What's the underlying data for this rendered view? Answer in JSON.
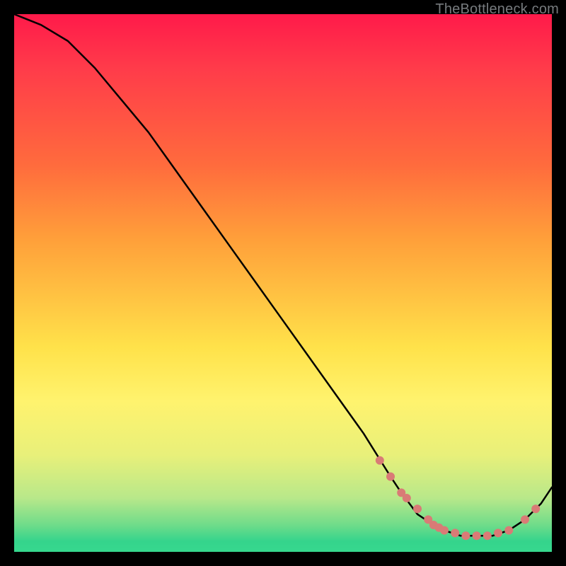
{
  "attribution": "TheBottleneck.com",
  "colors": {
    "background": "#000000",
    "curve": "#000000",
    "marker": "#d97b76",
    "gradient_top": "#ff1a4a",
    "gradient_bottom": "#36d88e"
  },
  "chart_data": {
    "type": "line",
    "title": "",
    "xlabel": "",
    "ylabel": "",
    "xlim": [
      0,
      100
    ],
    "ylim": [
      0,
      100
    ],
    "grid": false,
    "legend": false,
    "series": [
      {
        "name": "curve",
        "x": [
          0,
          5,
          10,
          15,
          20,
          25,
          30,
          35,
          40,
          45,
          50,
          55,
          60,
          65,
          70,
          72,
          75,
          78,
          80,
          83,
          86,
          89,
          92,
          95,
          98,
          100
        ],
        "y": [
          100,
          98,
          95,
          90,
          84,
          78,
          71,
          64,
          57,
          50,
          43,
          36,
          29,
          22,
          14,
          11,
          7,
          5,
          4,
          3,
          3,
          3,
          4,
          6,
          9,
          12
        ]
      }
    ],
    "markers": [
      {
        "x": 68,
        "y": 17
      },
      {
        "x": 70,
        "y": 14
      },
      {
        "x": 72,
        "y": 11
      },
      {
        "x": 73,
        "y": 10
      },
      {
        "x": 75,
        "y": 8
      },
      {
        "x": 77,
        "y": 6
      },
      {
        "x": 78,
        "y": 5
      },
      {
        "x": 79,
        "y": 4.5
      },
      {
        "x": 80,
        "y": 4
      },
      {
        "x": 82,
        "y": 3.5
      },
      {
        "x": 84,
        "y": 3
      },
      {
        "x": 86,
        "y": 3
      },
      {
        "x": 88,
        "y": 3
      },
      {
        "x": 90,
        "y": 3.5
      },
      {
        "x": 92,
        "y": 4
      },
      {
        "x": 95,
        "y": 6
      },
      {
        "x": 97,
        "y": 8
      }
    ]
  }
}
